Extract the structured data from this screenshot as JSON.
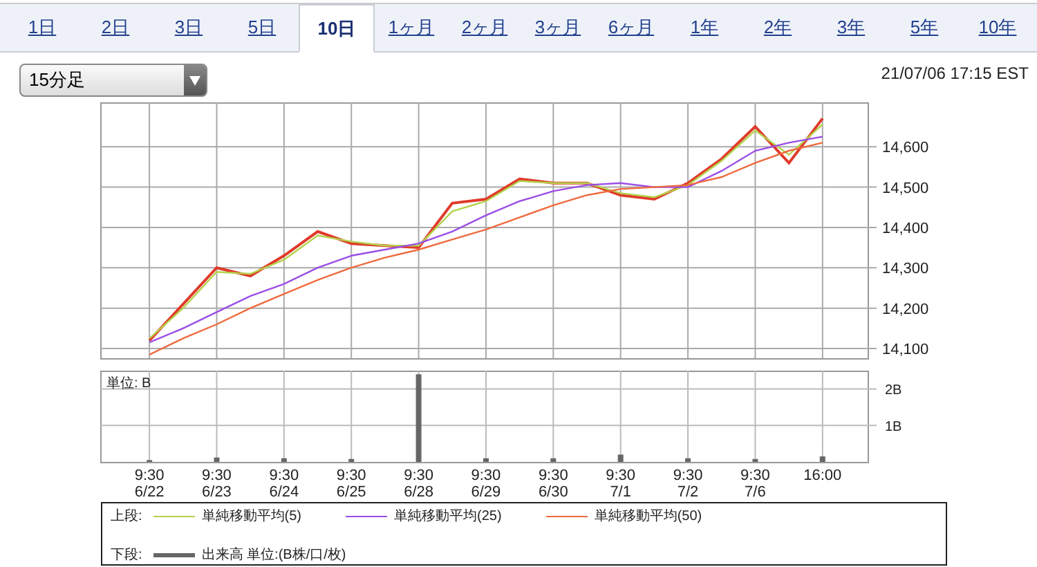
{
  "tabs": [
    {
      "label": "1日",
      "selected": false
    },
    {
      "label": "2日",
      "selected": false
    },
    {
      "label": "3日",
      "selected": false
    },
    {
      "label": "5日",
      "selected": false
    },
    {
      "label": "10日",
      "selected": true
    },
    {
      "label": "1ヶ月",
      "selected": false
    },
    {
      "label": "2ヶ月",
      "selected": false
    },
    {
      "label": "3ヶ月",
      "selected": false
    },
    {
      "label": "6ヶ月",
      "selected": false
    },
    {
      "label": "1年",
      "selected": false
    },
    {
      "label": "2年",
      "selected": false
    },
    {
      "label": "3年",
      "selected": false
    },
    {
      "label": "5年",
      "selected": false
    },
    {
      "label": "10年",
      "selected": false
    }
  ],
  "interval_select": {
    "value": "15分足"
  },
  "timestamp": "21/07/06 17:15 EST",
  "price_chart": {
    "chart_data": {
      "type": "line",
      "grid": true,
      "categories": [
        null,
        null,
        null,
        null,
        null,
        null,
        null,
        null,
        null,
        null,
        null,
        null,
        null,
        null,
        null,
        null,
        null,
        null,
        null,
        null,
        null
      ],
      "ylim": [
        14076,
        14710
      ],
      "yticks": [
        {
          "value": 14100,
          "label": "14,100"
        },
        {
          "value": 14200,
          "label": "14,200"
        },
        {
          "value": 14300,
          "label": "14,300"
        },
        {
          "value": 14400,
          "label": "14,400"
        },
        {
          "value": 14500,
          "label": "14,500"
        },
        {
          "value": 14600,
          "label": "14,600"
        }
      ],
      "series": [
        {
          "color": "#e03a2a",
          "values": [
            14120,
            14210,
            14300,
            14280,
            14330,
            14390,
            14360,
            14355,
            14350,
            14460,
            14470,
            14520,
            14510,
            14510,
            14480,
            14470,
            14510,
            14570,
            14650,
            14560,
            14670
          ]
        },
        {
          "color": "#b4d24c",
          "values": [
            14125,
            14200,
            14290,
            14285,
            14320,
            14380,
            14365,
            14355,
            14355,
            14440,
            14465,
            14515,
            14510,
            14510,
            14485,
            14475,
            14505,
            14565,
            14640,
            14580,
            14655
          ]
        },
        {
          "color": "#9a4ee6",
          "values": [
            14115,
            14150,
            14190,
            14230,
            14260,
            14300,
            14330,
            14345,
            14360,
            14390,
            14430,
            14465,
            14490,
            14505,
            14510,
            14500,
            14500,
            14540,
            14590,
            14610,
            14625
          ]
        },
        {
          "color": "#ef6a3e",
          "values": [
            14085,
            14125,
            14160,
            14200,
            14235,
            14270,
            14300,
            14325,
            14345,
            14370,
            14395,
            14425,
            14455,
            14480,
            14495,
            14500,
            14505,
            14525,
            14560,
            14590,
            14610
          ]
        }
      ]
    }
  },
  "volume_chart": {
    "date_labels": [
      "6/22",
      "6/23",
      "6/24",
      "6/25",
      "6/28",
      "6/29",
      "6/30",
      "7/1",
      "7/2",
      "7/6"
    ],
    "chart_data": {
      "type": "bar",
      "grid": true,
      "ylabel": "単位: B",
      "categories": [
        "9:30",
        "9:30",
        "9:30",
        "9:30",
        "9:30",
        "9:30",
        "9:30",
        "9:30",
        "9:30",
        "9:30",
        "16:00"
      ],
      "ylim": [
        0,
        2.5
      ],
      "yticks": [
        {
          "value": 1,
          "label": "1B"
        },
        {
          "value": 2,
          "label": "2B"
        }
      ],
      "series": [
        {
          "color": "#666666",
          "values": [
            0.05,
            0.12,
            0.1,
            0.08,
            2.4,
            0.1,
            0.1,
            0.2,
            0.1,
            0.08,
            0.15
          ]
        }
      ]
    }
  },
  "legend": {
    "rows": [
      {
        "label": "上段:",
        "items": [
          {
            "name": "単純移動平均(5)",
            "color": "#b4d24c"
          },
          {
            "name": "単純移動平均(25)",
            "color": "#9a4ee6"
          },
          {
            "name": "単純移動平均(50)",
            "color": "#ef6a3e"
          }
        ]
      },
      {
        "label": "下段:",
        "items": [
          {
            "name": "出来高 単位:(B株/口/枚)",
            "color": "#666666"
          }
        ]
      }
    ]
  }
}
